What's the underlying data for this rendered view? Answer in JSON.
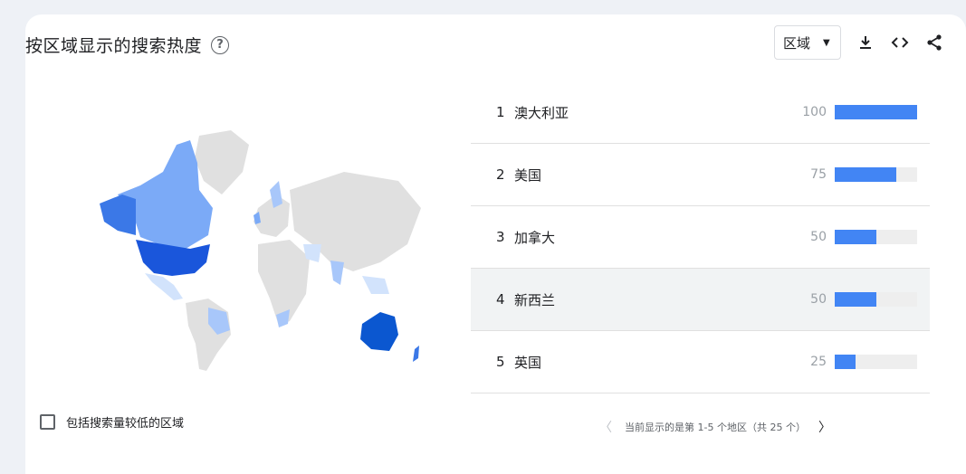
{
  "header": {
    "title": "按区域显示的搜索热度"
  },
  "toolbar": {
    "select_value": "区域"
  },
  "checkbox": {
    "label": "包括搜索量较低的区域"
  },
  "regions": [
    {
      "rank": "1",
      "name": "澳大利亚",
      "value": 100
    },
    {
      "rank": "2",
      "name": "美国",
      "value": 75
    },
    {
      "rank": "3",
      "name": "加拿大",
      "value": 50
    },
    {
      "rank": "4",
      "name": "新西兰",
      "value": 50
    },
    {
      "rank": "5",
      "name": "英国",
      "value": 25
    }
  ],
  "pager": {
    "text": "当前显示的是第 1-5 个地区（共 25 个）"
  },
  "colors": {
    "bar": "#4285f4",
    "track": "#eeeeee",
    "map_gray": "#e0e0e0",
    "high": "#1a56db",
    "mid": "#3b78e7",
    "low": "#a8c7fa"
  }
}
